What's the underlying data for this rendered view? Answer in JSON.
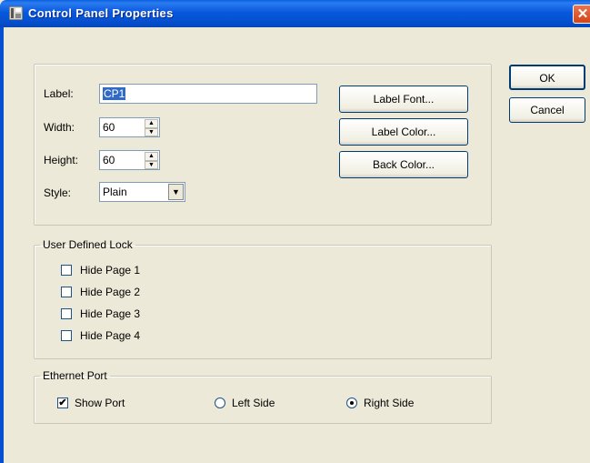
{
  "window": {
    "title": "Control Panel Properties",
    "close_glyph": "✕"
  },
  "properties": {
    "label_caption": "Label:",
    "label_value": "CP1",
    "width_caption": "Width:",
    "width_value": "60",
    "height_caption": "Height:",
    "height_value": "60",
    "style_caption": "Style:",
    "style_value": "Plain"
  },
  "buttons": {
    "label_font": "Label Font...",
    "label_color": "Label Color...",
    "back_color": "Back Color...",
    "ok": "OK",
    "cancel": "Cancel"
  },
  "user_defined_lock": {
    "title": "User Defined Lock",
    "items": [
      {
        "label": "Hide Page 1",
        "checked": false
      },
      {
        "label": "Hide Page 2",
        "checked": false
      },
      {
        "label": "Hide Page 3",
        "checked": false
      },
      {
        "label": "Hide Page 4",
        "checked": false
      }
    ]
  },
  "ethernet_port": {
    "title": "Ethernet Port",
    "show_port": "Show Port",
    "show_port_checked": true,
    "left_side": "Left Side",
    "right_side": "Right Side",
    "selected_side": "right"
  },
  "colors": {
    "titlebar": "#0550d0",
    "dialog_bg": "#ece9d8",
    "selection": "#316ac5"
  }
}
